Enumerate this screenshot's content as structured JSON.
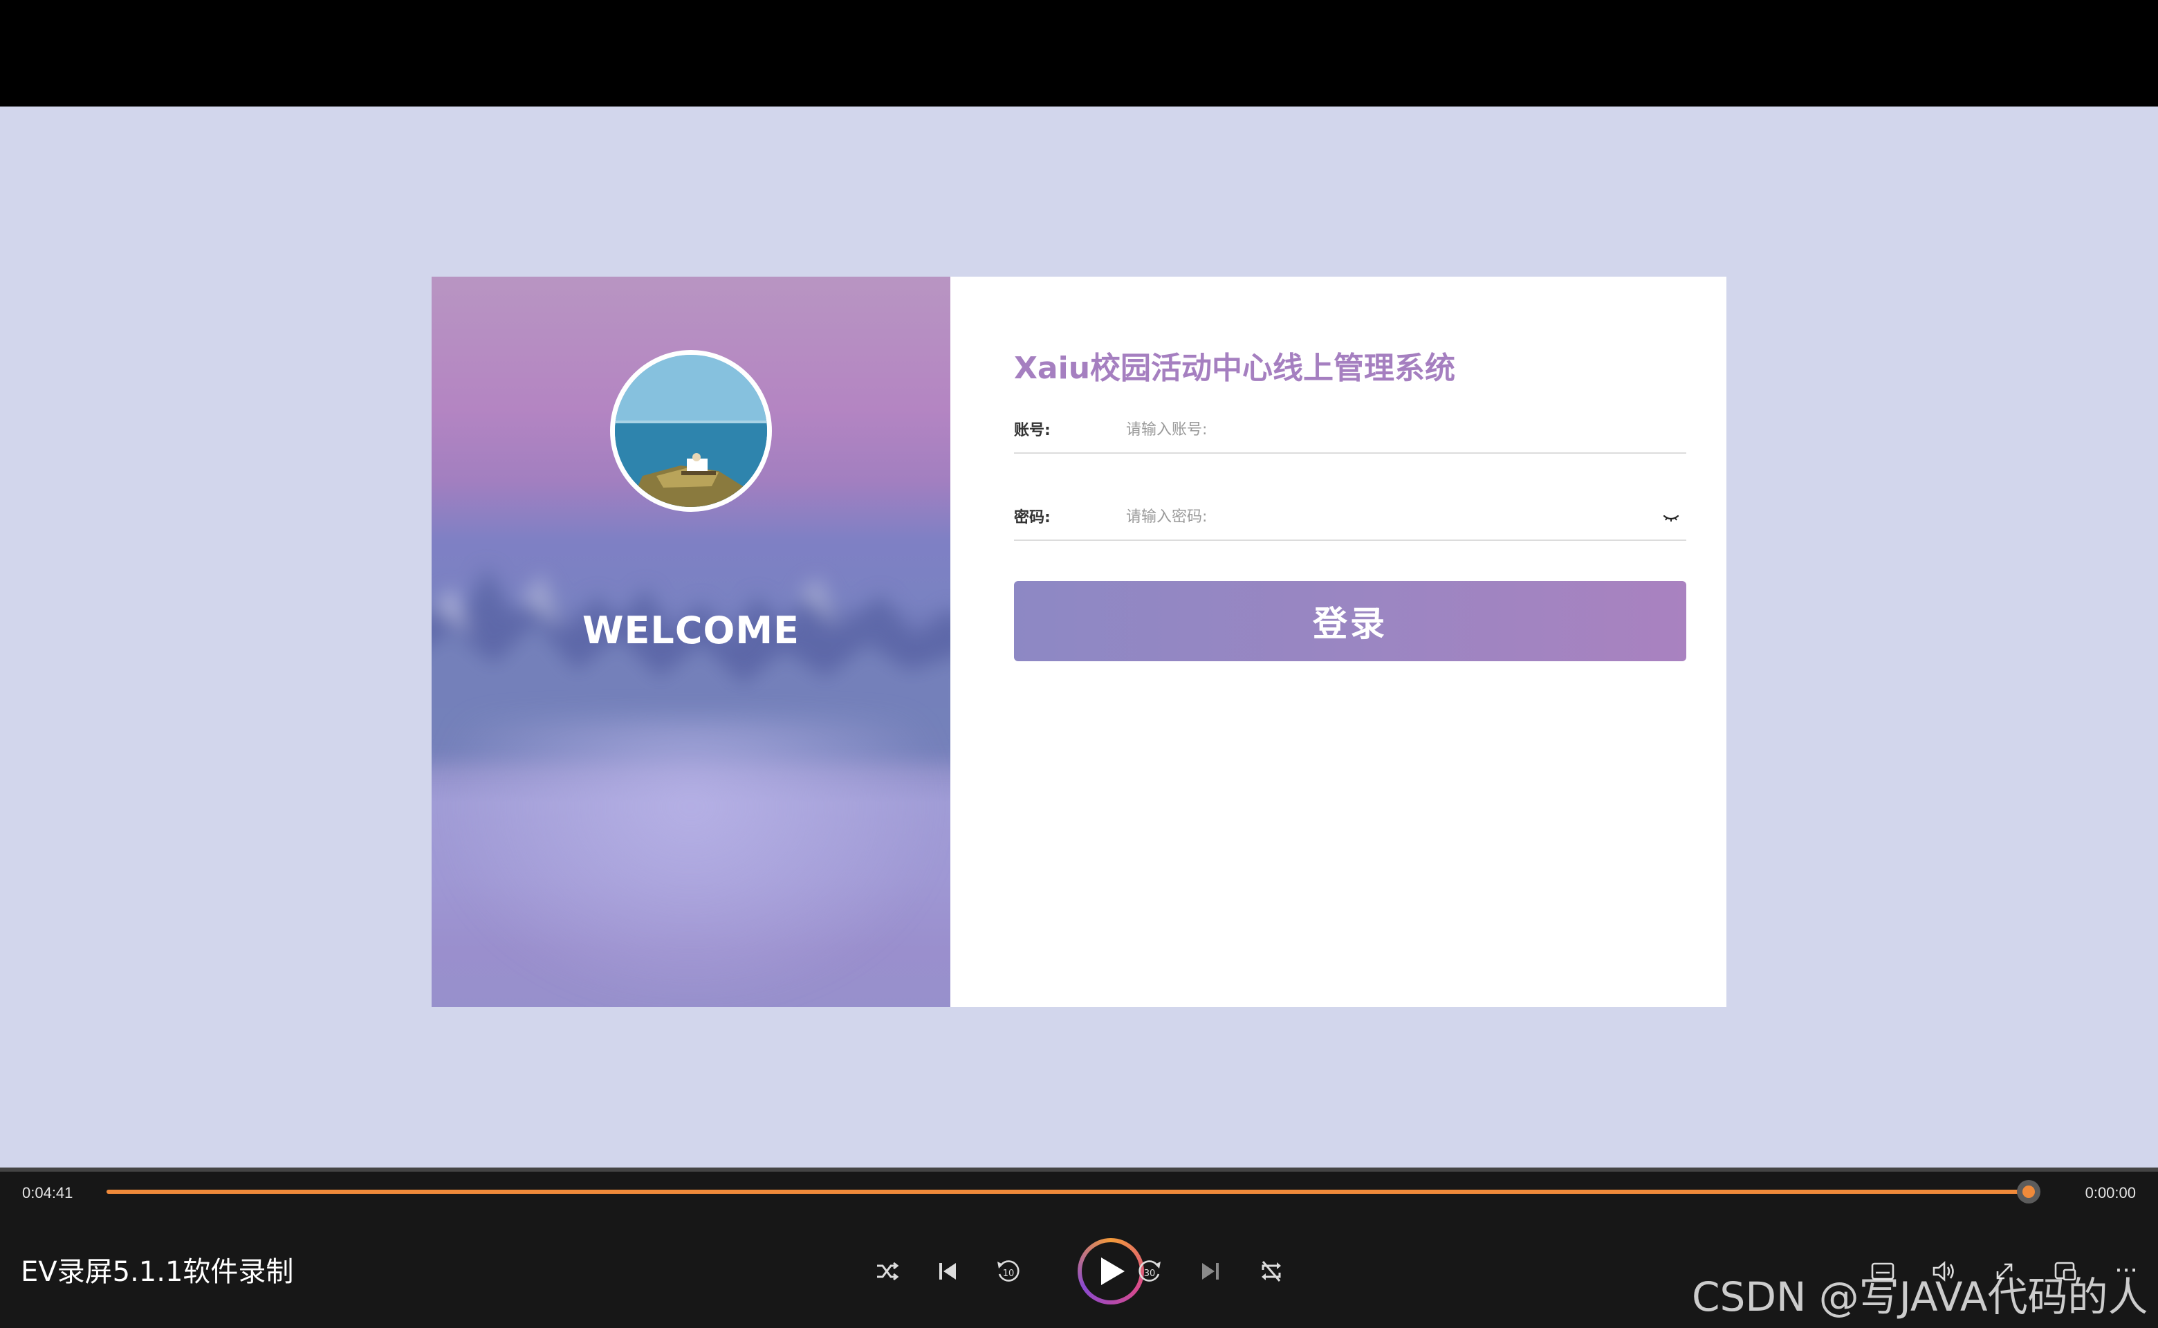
{
  "login": {
    "welcome": "WELCOME",
    "system_title": "Xaiu校园活动中心线上管理系统",
    "account_label": "账号:",
    "account_placeholder": "请输入账号:",
    "password_label": "密码:",
    "password_placeholder": "请输入密码:",
    "login_button": "登录"
  },
  "player": {
    "elapsed": "0:04:41",
    "remaining": "0:00:00",
    "progress_percent": 99.4,
    "title": "EV录屏5.1.1软件录制",
    "accent_color": "#f08a3a",
    "controls": [
      "shuffle-icon",
      "skip-previous-icon",
      "rewind-10-icon",
      "play-icon",
      "forward-30-icon",
      "skip-next-icon",
      "repeat-off-icon",
      "subtitles-icon",
      "volume-icon",
      "expand-icon",
      "mini-player-icon",
      "more-icon"
    ],
    "rewind_label": "10",
    "forward_label": "30",
    "more_label": "..."
  },
  "watermark": "CSDN @写JAVA代码的人"
}
